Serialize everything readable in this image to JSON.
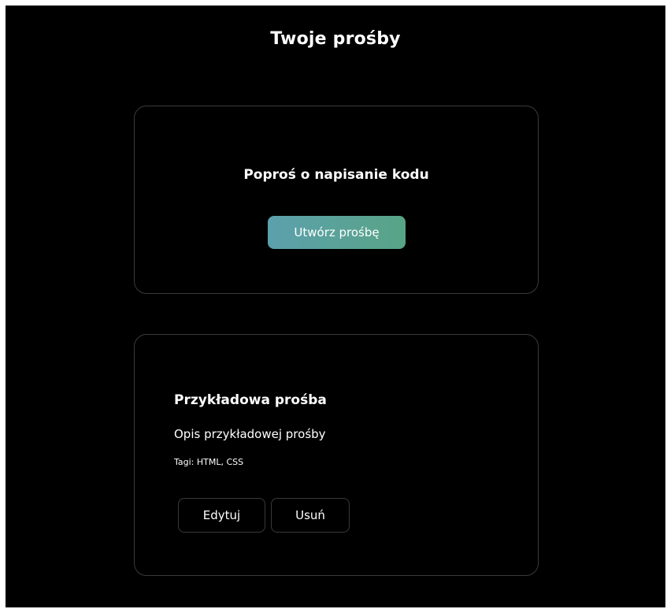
{
  "page": {
    "title": "Twoje prośby"
  },
  "create_card": {
    "heading": "Poproś o napisanie kodu",
    "button_label": "Utwórz prośbę"
  },
  "request_card": {
    "title": "Przykładowa prośba",
    "description": "Opis przykładowej prośby",
    "tags": "Tagi: HTML, CSS",
    "edit_label": "Edytuj",
    "delete_label": "Usuń"
  },
  "colors": {
    "background": "#000000",
    "card_border": "#3a3a3a",
    "button_gradient_start": "#5ca0ad",
    "button_gradient_end": "#58a486",
    "text": "#ffffff"
  }
}
